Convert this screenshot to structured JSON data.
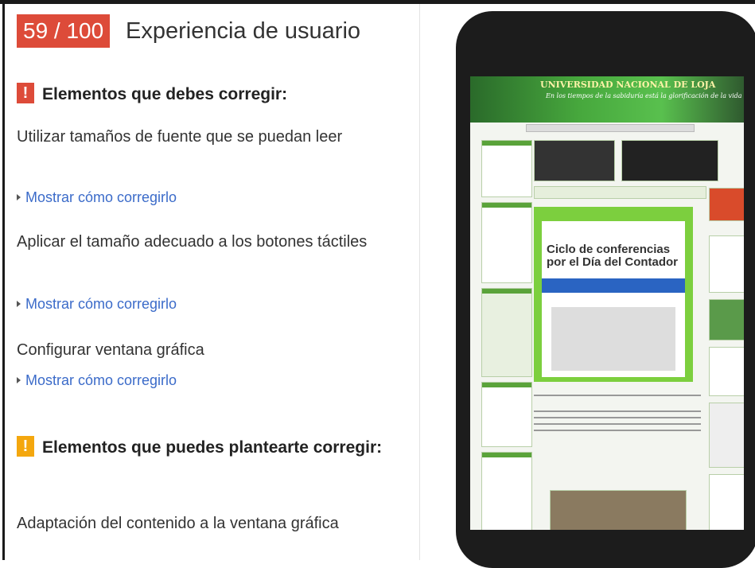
{
  "header": {
    "score": "59 / 100",
    "title": "Experiencia de usuario"
  },
  "must_fix": {
    "badge": "!",
    "heading": "Elementos que debes corregir:",
    "items": [
      {
        "text": "Utilizar tamaños de fuente que se puedan leer",
        "link": "Mostrar cómo corregirlo"
      },
      {
        "text": "Aplicar el tamaño adecuado a los botones táctiles",
        "link": "Mostrar cómo corregirlo"
      },
      {
        "text": "Configurar ventana gráfica",
        "link": "Mostrar cómo corregirlo"
      }
    ]
  },
  "consider_fix": {
    "badge": "!",
    "heading": "Elementos que puedes plantearte corregir:",
    "items": [
      {
        "text": "Adaptación del contenido a la ventana gráfica"
      }
    ]
  },
  "phone_preview": {
    "site_title": "UNIVERSIDAD NACIONAL DE LOJA",
    "site_subtitle": "En los tiempos de la sabiduría está la glorificación de la vida",
    "poster_title_1": "Ciclo de conferencias",
    "poster_title_2": "por el Día del Contador",
    "colors": {
      "header": "#47a83d",
      "poster": "#7ccf3e",
      "bar": "#2a64c2"
    }
  },
  "colors": {
    "score_bg": "#dd4b39",
    "must_fix_badge": "#dd4b39",
    "consider_badge": "#f4a70e",
    "link": "#3b6bc9"
  }
}
